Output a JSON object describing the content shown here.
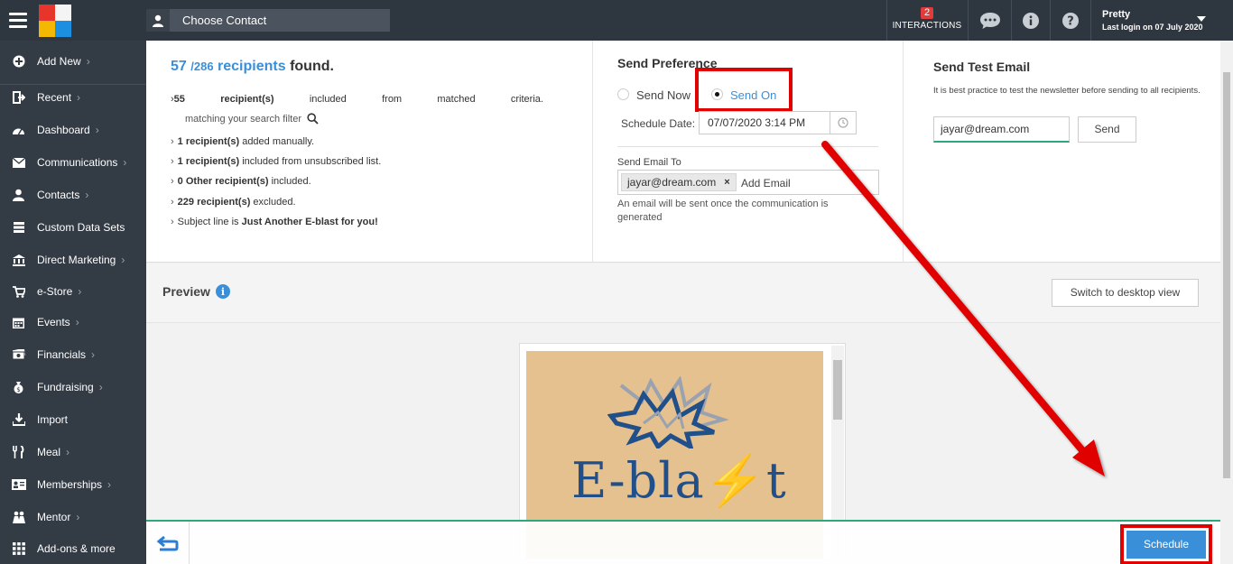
{
  "topbar": {
    "choose_contact": "Choose Contact",
    "interactions_count": "2",
    "interactions_label": "INTERACTIONS",
    "user_name": "Pretty",
    "last_login": "Last login on 07 July 2020"
  },
  "sidebar": {
    "items": [
      {
        "label": "Add New",
        "icon": "plus-circle-icon"
      },
      {
        "label": "Recent",
        "icon": "sign-out-icon"
      },
      {
        "label": "Dashboard",
        "icon": "dashboard-icon"
      },
      {
        "label": "Communications",
        "icon": "envelope-icon"
      },
      {
        "label": "Contacts",
        "icon": "user-icon"
      },
      {
        "label": "Custom Data Sets",
        "icon": "layers-icon"
      },
      {
        "label": "Direct Marketing",
        "icon": "bank-icon"
      },
      {
        "label": "e-Store",
        "icon": "cart-icon"
      },
      {
        "label": "Events",
        "icon": "calendar-icon"
      },
      {
        "label": "Financials",
        "icon": "money-icon"
      },
      {
        "label": "Fundraising",
        "icon": "money-bag-icon"
      },
      {
        "label": "Import",
        "icon": "download-icon"
      },
      {
        "label": "Meal",
        "icon": "cutlery-icon"
      },
      {
        "label": "Memberships",
        "icon": "id-card-icon"
      },
      {
        "label": "Mentor",
        "icon": "people-icon"
      },
      {
        "label": "Add-ons & more",
        "icon": "grid-icon"
      }
    ]
  },
  "summary": {
    "count": "57",
    "total": "/286",
    "recipients_word": "recipients",
    "found_word": "found.",
    "line1": [
      "55",
      "recipient(s)",
      "included",
      "from",
      "matched",
      "criteria."
    ],
    "line1_sub": "matching your search filter",
    "line2_bold": "1 recipient(s)",
    "line2_rest": " added manually.",
    "line3_bold": "1 recipient(s)",
    "line3_rest": " included from unsubscribed list.",
    "line4_bold": "0 Other recipient(s)",
    "line4_rest": " included.",
    "line5_bold": "229 recipient(s)",
    "line5_rest": " excluded.",
    "line6_pre": "Subject line is ",
    "line6_bold": "Just Another E-blast for you!"
  },
  "send_preference": {
    "title": "Send Preference",
    "send_now": "Send Now",
    "send_on": "Send On",
    "schedule_date_label": "Schedule Date:",
    "schedule_date_value": "07/07/2020 3:14 PM",
    "send_email_to_label": "Send Email To",
    "email_chip": "jayar@dream.com",
    "add_email_placeholder": "Add Email",
    "note": "An email will be sent once the communication is generated"
  },
  "test_email": {
    "title": "Send Test Email",
    "description": "It is best practice to test the newsletter before sending to all recipients.",
    "email_value": "jayar@dream.com",
    "send_label": "Send"
  },
  "preview": {
    "title": "Preview",
    "switch_label": "Switch to desktop view",
    "brand_text": "E-bla",
    "brand_text_end": "t"
  },
  "bottom": {
    "schedule_label": "Schedule"
  },
  "colors": {
    "accent_blue": "#3a8fd9",
    "highlight_red": "#e00000",
    "green": "#2ea87a"
  }
}
